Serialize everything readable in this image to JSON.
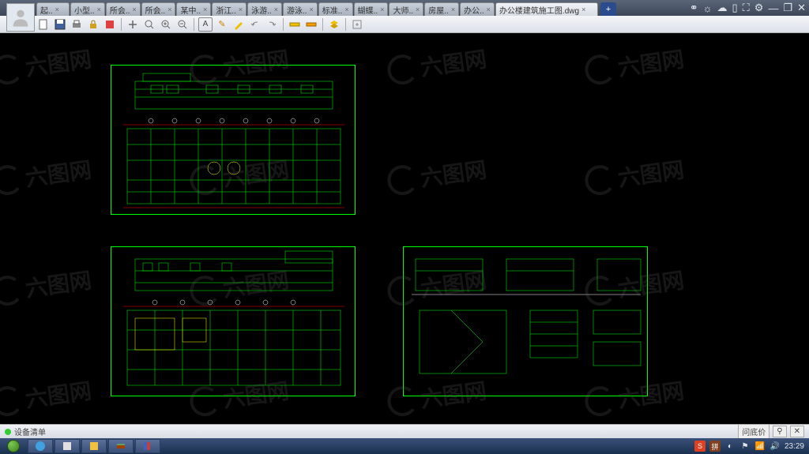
{
  "app": {
    "avatar_alt": "用户头像"
  },
  "tabs": [
    {
      "label": "起..",
      "active": false
    },
    {
      "label": "小型..",
      "active": false
    },
    {
      "label": "所会..",
      "active": false
    },
    {
      "label": "所会..",
      "active": false
    },
    {
      "label": "某中..",
      "active": false
    },
    {
      "label": "浙江..",
      "active": false
    },
    {
      "label": "泳游..",
      "active": false
    },
    {
      "label": "游泳..",
      "active": false
    },
    {
      "label": "标准..",
      "active": false
    },
    {
      "label": "蝴蝶..",
      "active": false
    },
    {
      "label": "大师..",
      "active": false
    },
    {
      "label": "房屋..",
      "active": false
    },
    {
      "label": "办公..",
      "active": false
    },
    {
      "label": "办公楼建筑施工图.dwg",
      "active": true
    }
  ],
  "window_controls": {
    "people": "⚭",
    "share": "☼",
    "cloud": "☁",
    "phone": "▯",
    "fullscreen": "⛶",
    "settings": "⚙",
    "minimize": "—",
    "restore": "❐",
    "close": "✕"
  },
  "toolbar": {
    "new": "新建",
    "save": "保存",
    "print": "打印",
    "a_tool": "A",
    "pencil": "✎"
  },
  "status": {
    "list_label": "设备清单",
    "price_label": "问底价",
    "search": "⚲",
    "close": "✕"
  },
  "tray": {
    "time": "23:29",
    "input_s": "S",
    "input_pin": "拼"
  },
  "watermark_text": "六图网"
}
